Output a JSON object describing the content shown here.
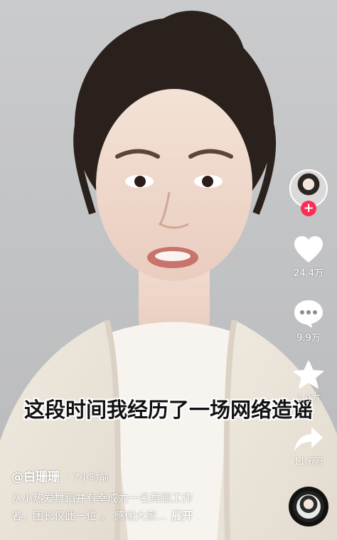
{
  "subtitle": "这段时间我经历了一场网络造谣",
  "actions": {
    "likes": "24.4万",
    "comments": "9.9万",
    "favorites": "3.9万",
    "shares": "11.6万"
  },
  "caption": {
    "author": "@白珊珊",
    "dot": "·",
    "time": "7小时前",
    "line1": "从小热爱舞蹈并有幸成为一名舞蹈工作",
    "line2": "者，团长仅此一位 。 感谢大家...",
    "expand": "展开"
  },
  "icons": {
    "follow": "plus-icon",
    "like": "heart-icon",
    "comment": "comment-bubble-icon",
    "favorite": "star-icon",
    "share": "share-arrow-icon",
    "music": "music-disc-icon"
  },
  "colors": {
    "follow_badge": "#fe2c55",
    "text": "#ffffff",
    "subtitle_text": "#111111",
    "subtitle_outline": "#ffffff"
  }
}
